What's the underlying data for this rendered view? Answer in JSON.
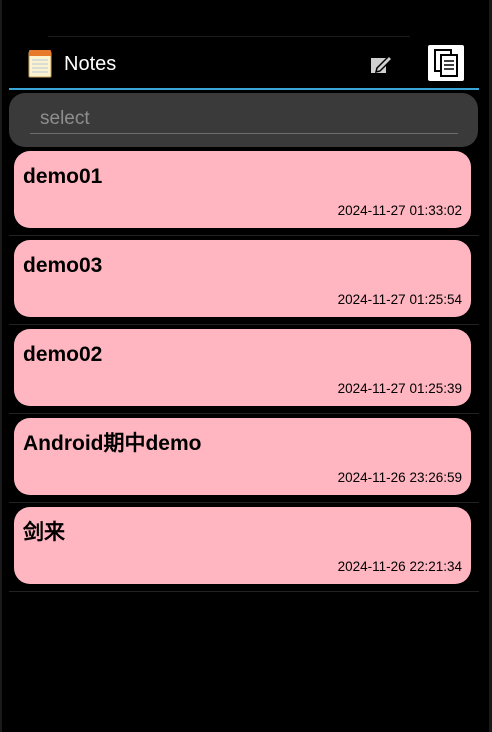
{
  "action_bar": {
    "title": "Notes",
    "app_icon": "notepad-icon",
    "new_note_icon": "edit-icon",
    "copy_icon": "copy-icon"
  },
  "search": {
    "placeholder": "select",
    "value": ""
  },
  "notes": [
    {
      "title": "demo01",
      "timestamp": "2024-11-27 01:33:02"
    },
    {
      "title": "demo03",
      "timestamp": "2024-11-27 01:25:54"
    },
    {
      "title": "demo02",
      "timestamp": "2024-11-27 01:25:39"
    },
    {
      "title": "Android期中demo",
      "timestamp": "2024-11-26 23:26:59"
    },
    {
      "title": "剑来",
      "timestamp": "2024-11-26 22:21:34"
    }
  ],
  "colors": {
    "card_background": "#ffb6c1",
    "accent_underline": "#3aa6d5",
    "search_background": "#3a3a3a"
  }
}
